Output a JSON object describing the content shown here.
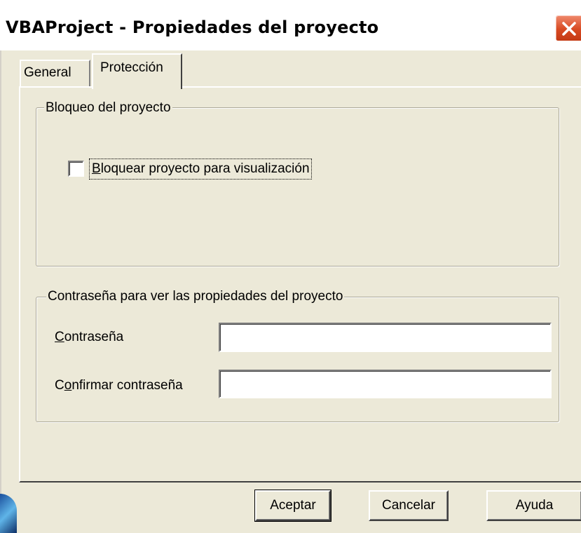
{
  "window": {
    "title": "VBAProject - Propiedades del proyecto",
    "close_icon": "close-icon"
  },
  "tabs": [
    {
      "label": "General",
      "selected": false
    },
    {
      "label": "Protección",
      "selected": true
    }
  ],
  "lock_group": {
    "legend": "Bloqueo del proyecto",
    "checkbox": {
      "label_mnemonic": "B",
      "label_rest": "loquear proyecto para visualización",
      "checked": false
    }
  },
  "password_group": {
    "legend": "Contraseña para ver las propiedades del proyecto",
    "password": {
      "label_mnemonic": "C",
      "label_rest": "ontraseña",
      "value": ""
    },
    "confirm": {
      "label_pre": "C",
      "label_mnemonic": "o",
      "label_rest": "nfirmar contraseña",
      "value": ""
    }
  },
  "buttons": {
    "ok": "Aceptar",
    "cancel": "Cancelar",
    "help": "Ayuda"
  },
  "colors": {
    "dialog_bg": "#ece9d8",
    "close_button": "#d84a22"
  }
}
